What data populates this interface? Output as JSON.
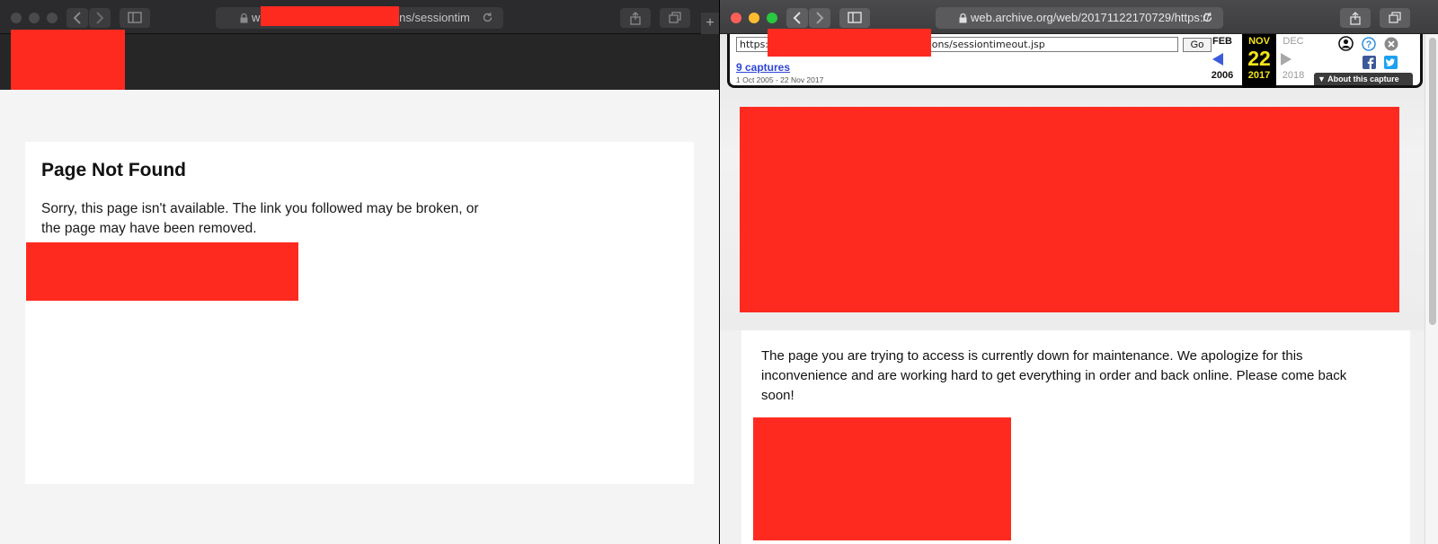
{
  "left_window": {
    "url_visible_start": "w",
    "url_visible_end": "ions/sessiontim",
    "title": "Page Not Found",
    "message": "Sorry, this page isn't available. The link you followed may be broken, or the page may have been removed."
  },
  "right_window": {
    "url": "web.archive.org/web/20171122170729/https://",
    "wayback": {
      "input_prefix": "https:/",
      "input_suffix": "ons/sessiontimeout.jsp",
      "go_label": "Go",
      "captures_label": "9 captures",
      "date_range": "1 Oct 2005 - 22 Nov 2017",
      "prev": {
        "month": "FEB",
        "year": "2006"
      },
      "current": {
        "month": "NOV",
        "day": "22",
        "year": "2017"
      },
      "next": {
        "month": "DEC",
        "year": "2018"
      },
      "about_label": "About this capture"
    },
    "message": "The page you are trying to access is currently down for maintenance. We apologize for this inconvenience and are working hard to get everything in order and back online. Please come back soon!"
  },
  "colors": {
    "redaction": "#ff2a1f",
    "wayback_link": "#2e45d6",
    "wayback_highlight": "#f5e51a"
  },
  "icons": [
    "back-icon",
    "forward-icon",
    "sidebar-icon",
    "lock-icon",
    "reload-icon",
    "share-icon",
    "tabs-icon",
    "user-icon",
    "help-icon",
    "close-icon",
    "facebook-icon",
    "twitter-icon"
  ]
}
